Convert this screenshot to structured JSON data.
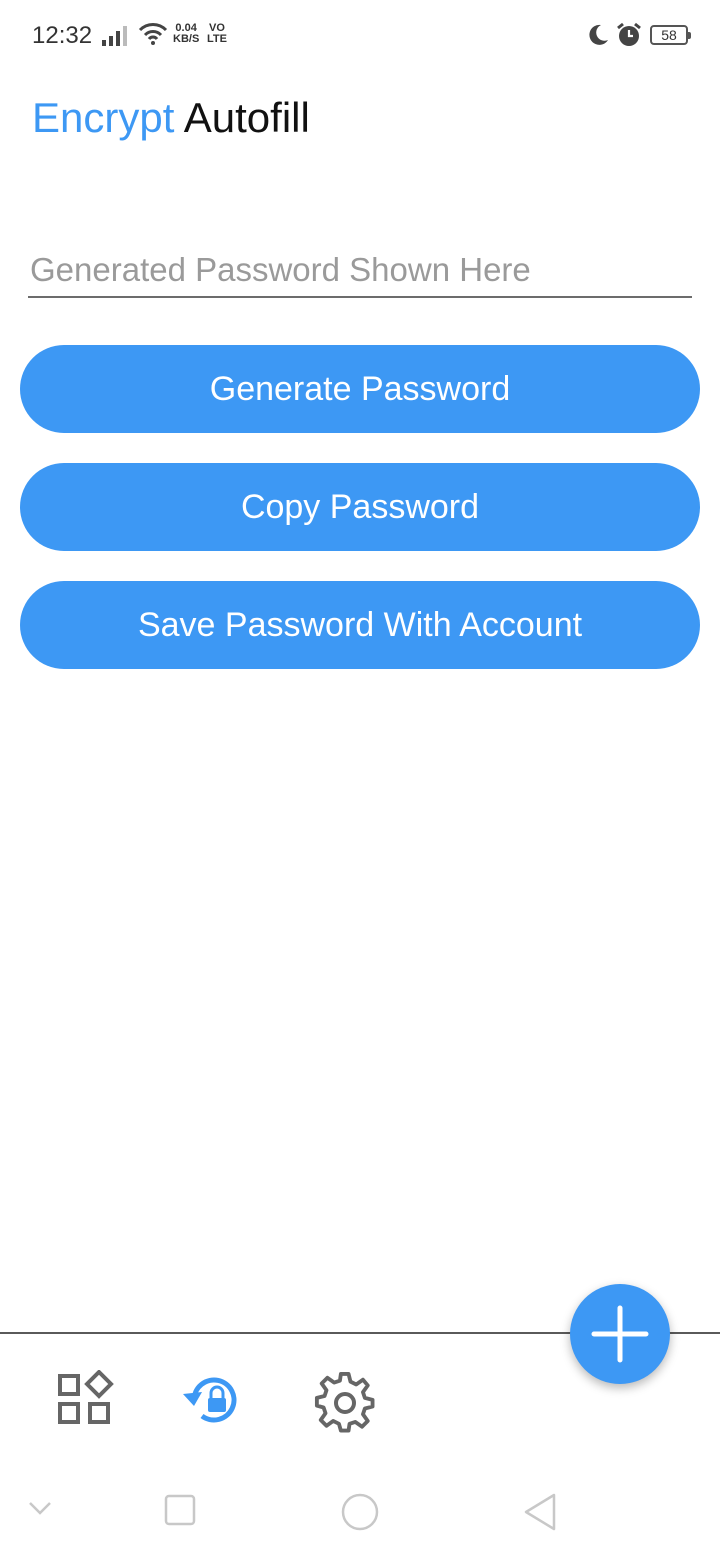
{
  "status_bar": {
    "time": "12:32",
    "net_speed_value": "0.04",
    "net_speed_unit": "KB/S",
    "volte_top": "VO",
    "volte_bottom": "LTE",
    "battery": "58",
    "icons": [
      "signal-icon",
      "wifi-icon",
      "moon-icon",
      "alarm-icon",
      "battery-icon"
    ]
  },
  "app": {
    "title_part1": "Encrypt",
    "title_part2": "Autofill",
    "accent_color": "#3d98f4"
  },
  "password_field": {
    "value": "",
    "placeholder": "Generated Password Shown Here"
  },
  "buttons": {
    "generate": "Generate Password",
    "copy": "Copy Password",
    "save": "Save Password With Account"
  },
  "bottom_nav": {
    "items": [
      "apps-icon",
      "vault-lock-icon",
      "settings-gear-icon"
    ],
    "active": "vault-lock-icon",
    "fab": "add-icon"
  },
  "system_nav": [
    "collapse-icon",
    "recents-icon",
    "home-icon",
    "back-icon"
  ]
}
